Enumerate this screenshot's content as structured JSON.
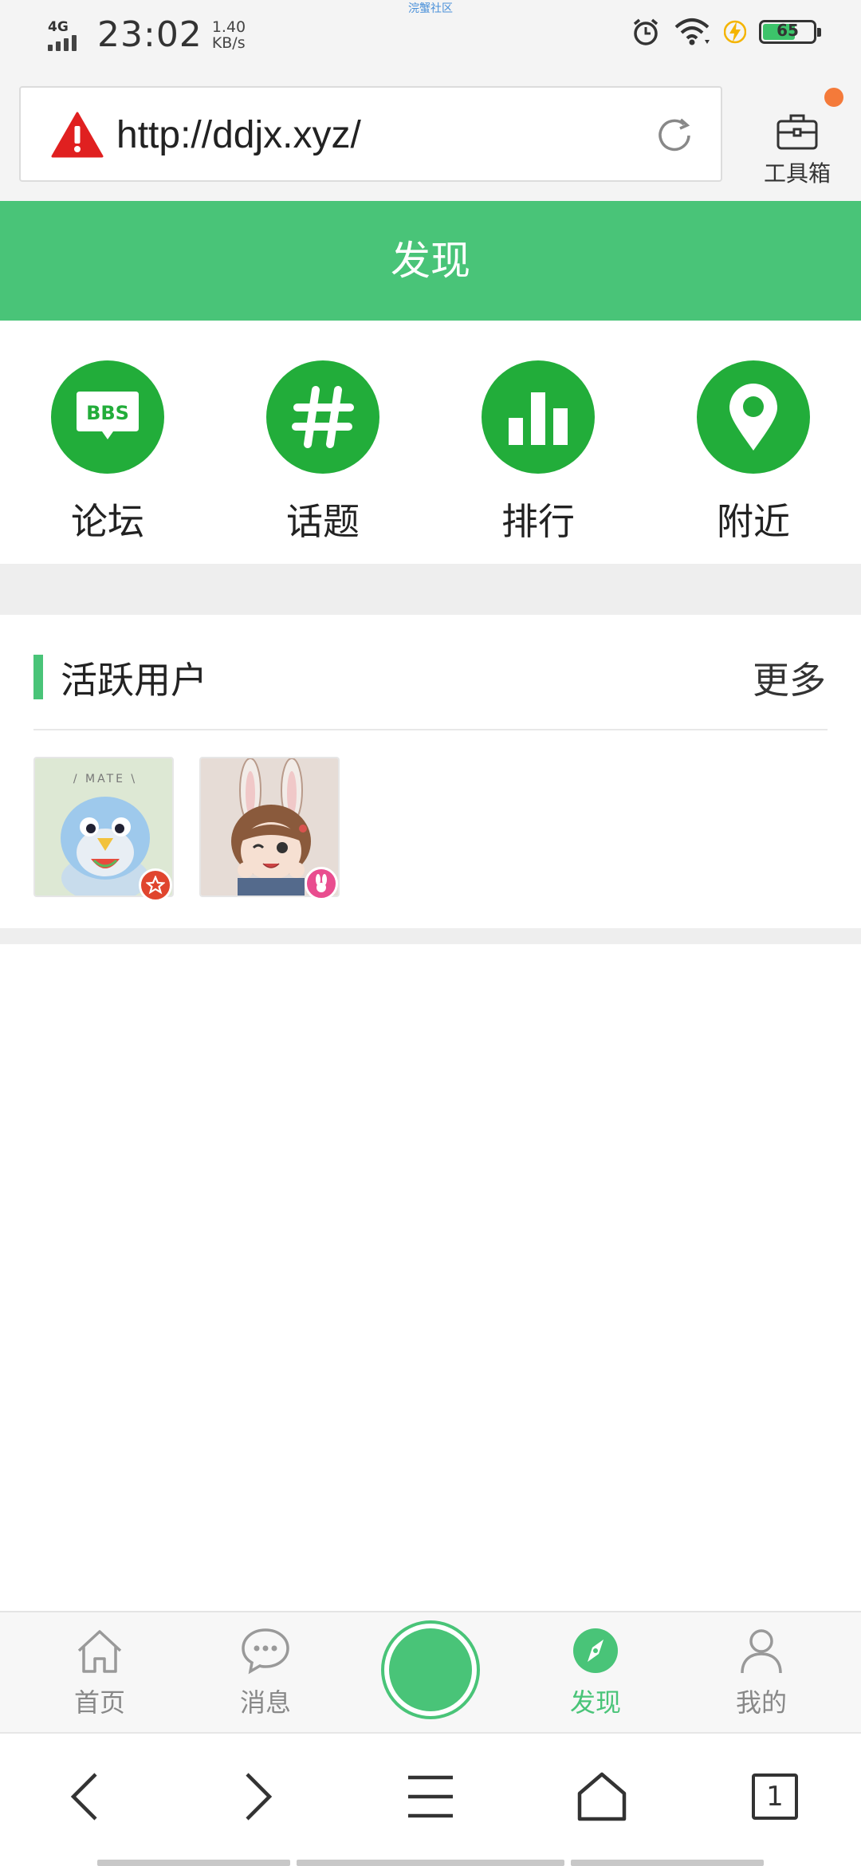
{
  "status_bar": {
    "network": "4G",
    "time": "23:02",
    "speed_value": "1.40",
    "speed_unit": "KB/s",
    "center_caption": "浣蟹社区",
    "battery_level": "65",
    "battery_color": "#3cc36a"
  },
  "browser": {
    "url": "http://ddjx.xyz/",
    "warning_icon": "warning-triangle-icon",
    "reload_icon": "reload-icon",
    "toolbox_label": "工具箱",
    "toolbox_icon": "toolbox-icon"
  },
  "header": {
    "title": "发现",
    "color": "#49c478"
  },
  "quick_nav": [
    {
      "label": "论坛",
      "icon": "bbs-chat-icon"
    },
    {
      "label": "话题",
      "icon": "hashtag-icon"
    },
    {
      "label": "排行",
      "icon": "bar-chart-icon"
    },
    {
      "label": "附近",
      "icon": "location-pin-icon"
    }
  ],
  "active_users": {
    "title": "活跃用户",
    "more_label": "更多",
    "users": [
      {
        "avatar_desc": "penguin-plush-avatar",
        "badge": "star-badge"
      },
      {
        "avatar_desc": "bunny-girl-avatar",
        "badge": "bunny-badge"
      }
    ]
  },
  "tab_bar": {
    "tabs": [
      {
        "label": "首页",
        "icon": "home-icon"
      },
      {
        "label": "消息",
        "icon": "message-bubble-icon"
      },
      {
        "label": "发现",
        "icon": "compass-icon",
        "active": true
      },
      {
        "label": "我的",
        "icon": "person-icon"
      }
    ]
  },
  "browser_nav": {
    "tab_count": "1"
  }
}
